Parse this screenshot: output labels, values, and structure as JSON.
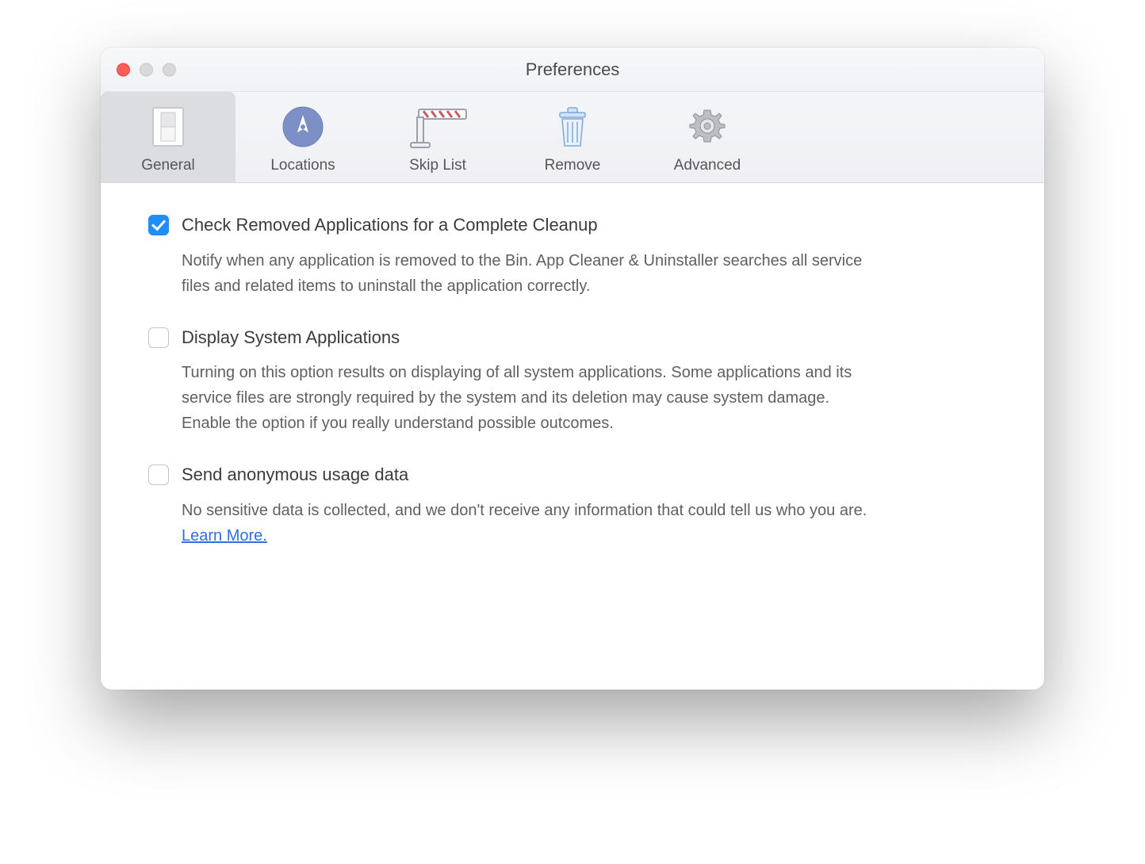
{
  "window": {
    "title": "Preferences"
  },
  "tabs": [
    {
      "id": "general",
      "label": "General",
      "selected": true
    },
    {
      "id": "locations",
      "label": "Locations",
      "selected": false
    },
    {
      "id": "skiplist",
      "label": "Skip List",
      "selected": false
    },
    {
      "id": "remove",
      "label": "Remove",
      "selected": false
    },
    {
      "id": "advanced",
      "label": "Advanced",
      "selected": false
    }
  ],
  "settings": {
    "cleanup": {
      "checked": true,
      "title": "Check Removed Applications for a Complete Cleanup",
      "desc": "Notify when any application is removed to the Bin. App Cleaner & Uninstaller searches all service files and related items to uninstall the application correctly."
    },
    "systemApps": {
      "checked": false,
      "title": "Display System Applications",
      "desc": "Turning on this option results on displaying of all system applications. Some applications and its service files are strongly required by the system and its deletion may cause system damage. Enable the option if you really understand possible outcomes."
    },
    "anonData": {
      "checked": false,
      "title": "Send anonymous usage data",
      "desc": "No sensitive data is collected, and we don't receive any information that could tell us who you are.   ",
      "link": "Learn More."
    }
  }
}
